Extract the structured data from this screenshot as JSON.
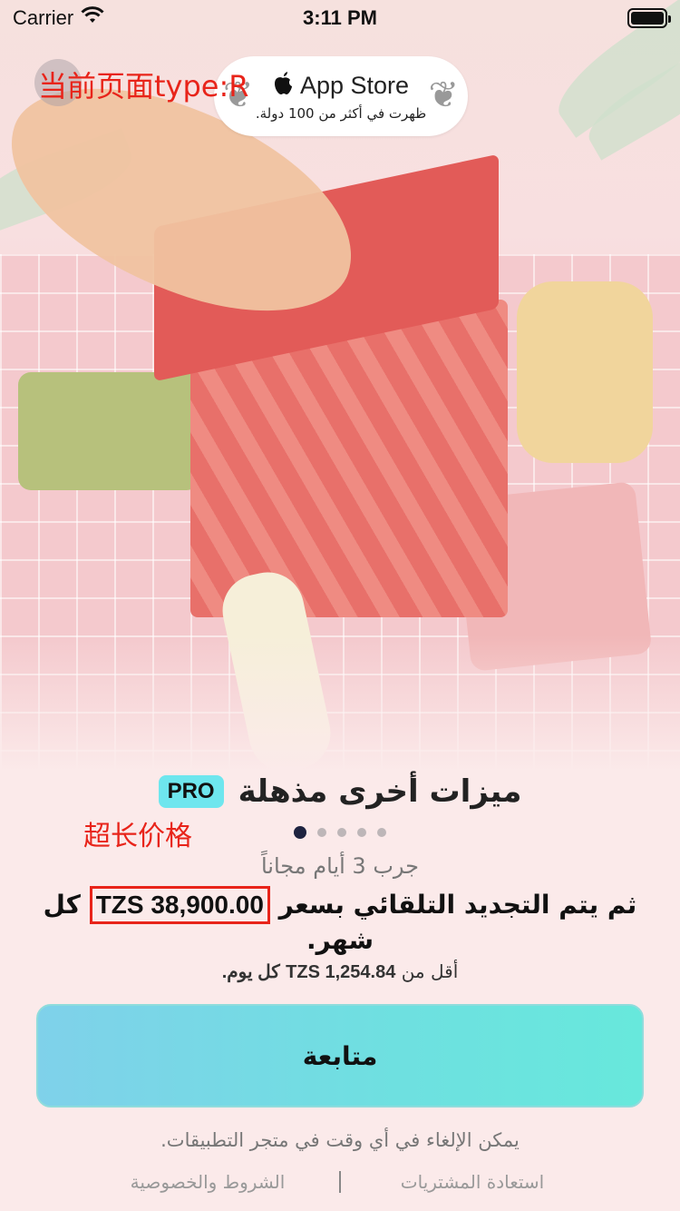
{
  "status_bar": {
    "carrier": "Carrier",
    "time": "3:11 PM",
    "wifi_icon": "wifi-icon",
    "battery_icon": "battery-icon"
  },
  "debug": {
    "page_type_label": "当前页面type:R",
    "annotation_long_price": "超长价格"
  },
  "app_store_badge": {
    "apple_icon": "apple-icon",
    "title": "App Store",
    "subtitle": "ظهرت في أكثر من 100 دولة."
  },
  "content": {
    "pro_badge": "PRO",
    "title": "ميزات أخرى مذهلة",
    "page_indicator": {
      "count": 5,
      "active_index": 0
    },
    "trial_text": "جرب 3 أيام مجاناً",
    "renew_prefix": "ثم يتم التجديد التلقائي بسعر",
    "renew_price": "TZS 38,900.00",
    "renew_suffix": "كل شهر.",
    "daily_prefix": "أقل من",
    "daily_price": "TZS 1,254.84",
    "daily_suffix": "كل يوم."
  },
  "cta": {
    "label": "متابعة"
  },
  "cancel_text": "يمكن الإلغاء في أي وقت في متجر التطبيقات.",
  "footer": {
    "restore": "استعادة المشتريات",
    "terms": "الشروط والخصوصية"
  },
  "colors": {
    "accent_cyan": "#6ee6ee",
    "annotation_red": "#e8241a",
    "background": "#fbeaea"
  }
}
